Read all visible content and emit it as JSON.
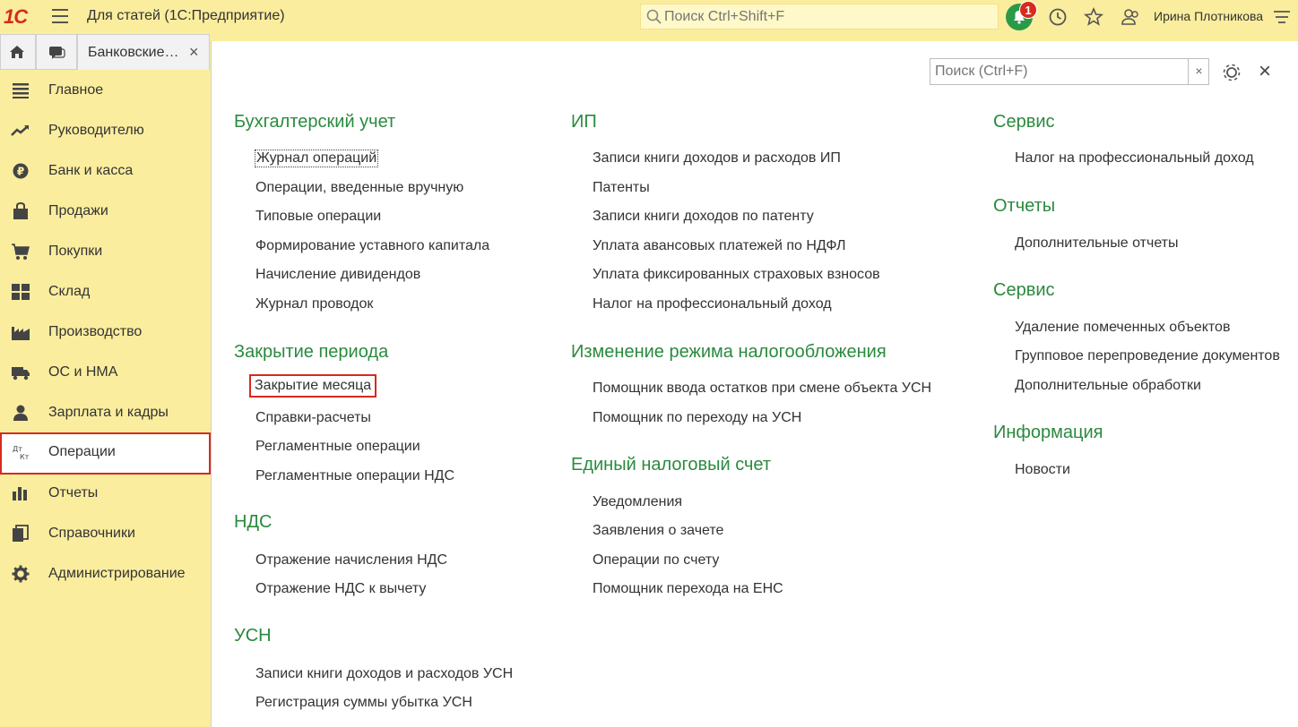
{
  "app": {
    "logo": "1С",
    "title": "Для статей  (1С:Предприятие)",
    "search_placeholder": "Поиск Ctrl+Shift+F",
    "notifications_count": "1",
    "user": "Ирина Плотникова"
  },
  "tabs": {
    "home_icon": "home-icon",
    "chat_icon": "chat-icon",
    "doc_tab": "Банковские…",
    "close": "×"
  },
  "sidebar": {
    "items": [
      {
        "label": "Главное",
        "icon": "list-icon"
      },
      {
        "label": "Руководителю",
        "icon": "trend-icon"
      },
      {
        "label": "Банк и касса",
        "icon": "coin-icon"
      },
      {
        "label": "Продажи",
        "icon": "bag-icon"
      },
      {
        "label": "Покупки",
        "icon": "cart-icon"
      },
      {
        "label": "Склад",
        "icon": "grid-icon"
      },
      {
        "label": "Производство",
        "icon": "factory-icon"
      },
      {
        "label": "ОС и НМА",
        "icon": "truck-icon"
      },
      {
        "label": "Зарплата и кадры",
        "icon": "person-icon"
      },
      {
        "label": "Операции",
        "icon": "dt-kt-icon",
        "active": true
      },
      {
        "label": "Отчеты",
        "icon": "barchart-icon"
      },
      {
        "label": "Справочники",
        "icon": "books-icon"
      },
      {
        "label": "Администрирование",
        "icon": "gear-icon"
      }
    ]
  },
  "panel": {
    "search_placeholder": "Поиск (Ctrl+F)",
    "clear": "×",
    "close": "×"
  },
  "col1": {
    "g1_title": "Бухгалтерский учет",
    "g1_items": [
      "Журнал операций",
      "Операции, введенные вручную",
      "Типовые операции",
      "Формирование уставного капитала",
      "Начисление дивидендов",
      "Журнал проводок"
    ],
    "g2_title": "Закрытие периода",
    "g2_items": [
      "Закрытие месяца",
      "Справки-расчеты",
      "Регламентные операции",
      "Регламентные операции НДС"
    ],
    "g3_title": "НДС",
    "g3_items": [
      "Отражение начисления НДС",
      "Отражение НДС к вычету"
    ],
    "g4_title": "УСН",
    "g4_items": [
      "Записи книги доходов и расходов УСН",
      "Регистрация суммы убытка УСН"
    ]
  },
  "col2": {
    "g1_title": "ИП",
    "g1_items": [
      "Записи книги доходов и расходов ИП",
      "Патенты",
      "Записи книги доходов по патенту",
      "Уплата авансовых платежей по НДФЛ",
      "Уплата фиксированных страховых взносов",
      "Налог на профессиональный доход"
    ],
    "g2_title": "Изменение режима налогообложения",
    "g2_items": [
      "Помощник ввода остатков при смене объекта УСН",
      "Помощник по переходу на УСН"
    ],
    "g3_title": "Единый налоговый счет",
    "g3_items": [
      "Уведомления",
      "Заявления о зачете",
      "Операции по счету",
      "Помощник перехода на ЕНС"
    ]
  },
  "col3": {
    "g1_title": "Сервис",
    "g1_items": [
      "Налог на профессиональный доход"
    ],
    "g2_title": "Отчеты",
    "g2_items": [
      "Дополнительные отчеты"
    ],
    "g3_title": "Сервис",
    "g3_items": [
      "Удаление помеченных объектов",
      "Групповое перепроведение документов",
      "Дополнительные обработки"
    ],
    "g4_title": "Информация",
    "g4_items": [
      "Новости"
    ]
  },
  "colors": {
    "accent_green": "#2a8a3e",
    "highlight_red": "#d52b1e",
    "sidebar_bg": "#fbed9e"
  }
}
